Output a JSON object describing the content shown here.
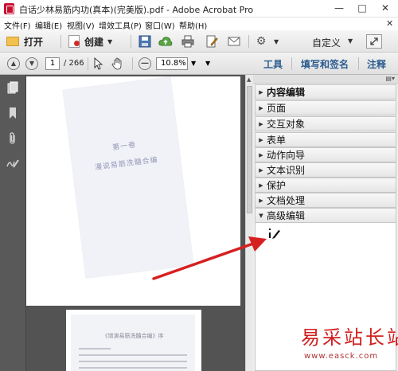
{
  "window": {
    "title": "白话少林易筋内功(真本)(完美版).pdf - Adobe Acrobat Pro",
    "minimize": "—",
    "maximize": "□",
    "close": "✕"
  },
  "menu": {
    "items": [
      "文件(F)",
      "编辑(E)",
      "视图(V)",
      "增效工具(P)",
      "窗口(W)",
      "帮助(H)"
    ],
    "close": "✕"
  },
  "toolbar": {
    "open_label": "打开",
    "create_label": "创建",
    "customize_label": "自定义"
  },
  "navbar": {
    "page_current": "1",
    "page_total": "/ 266",
    "zoom_value": "10.8%",
    "tabs": [
      "工具",
      "填写和签名",
      "注释"
    ]
  },
  "document": {
    "page1_title": "第一卷",
    "page1_subtitle": "漫说易筋洗髓合编",
    "page2_title": "《增演易筋洗髓合编》序"
  },
  "tools_panel": {
    "sections": [
      "内容编辑",
      "页面",
      "交互对象",
      "表单",
      "动作向导",
      "文本识别",
      "保护",
      "文档处理",
      "高级编辑"
    ],
    "expanded_section": "高级编辑"
  },
  "watermark": {
    "text": "易采站长站",
    "url": "www.easck.com"
  },
  "colors": {
    "accent_blue": "#2a5c8f",
    "annotation_red": "#d62020",
    "watermark_red": "#d11f1f"
  }
}
